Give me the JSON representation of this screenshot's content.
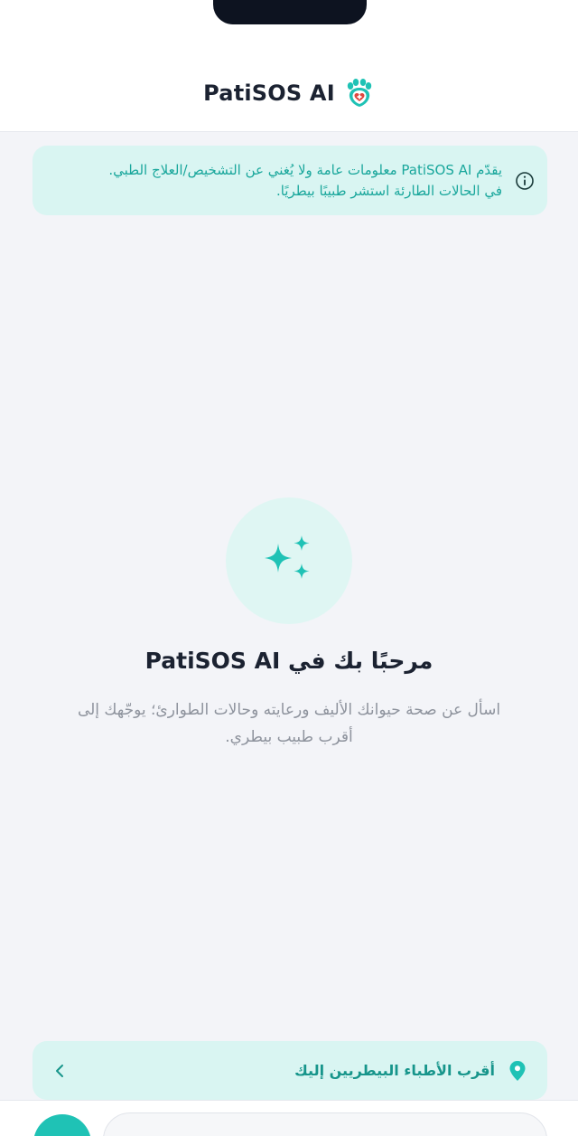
{
  "header": {
    "title": "PatiSOS AI",
    "logo_icon": "paw-heart-shield-icon"
  },
  "disclaimer": {
    "icon": "info-icon",
    "line1": "يقدّم PatiSOS AI معلومات عامة ولا يُغني عن التشخيص/العلاج الطبي.",
    "line2": "في الحالات الطارئة استشر طبيبًا بيطريًا."
  },
  "welcome": {
    "icon": "sparkles-icon",
    "title": "مرحبًا بك في PatiSOS AI",
    "subtitle": "اسأل عن صحة حيوانك الأليف ورعايته وحالات الطوارئ؛ يوجّهك إلى أقرب طبيب بيطري."
  },
  "nearest_vets": {
    "icon": "location-pin-icon",
    "label": "أقرب الأطباء البيطريين إليك",
    "chevron": "chevron-left-icon"
  },
  "colors": {
    "accent": "#1fc2b5",
    "accent_text": "#17958b",
    "panel_bg": "#d9f5f2",
    "page_bg": "#f3f4f8",
    "title_text": "#1b2231",
    "muted_text": "#8e939d"
  }
}
